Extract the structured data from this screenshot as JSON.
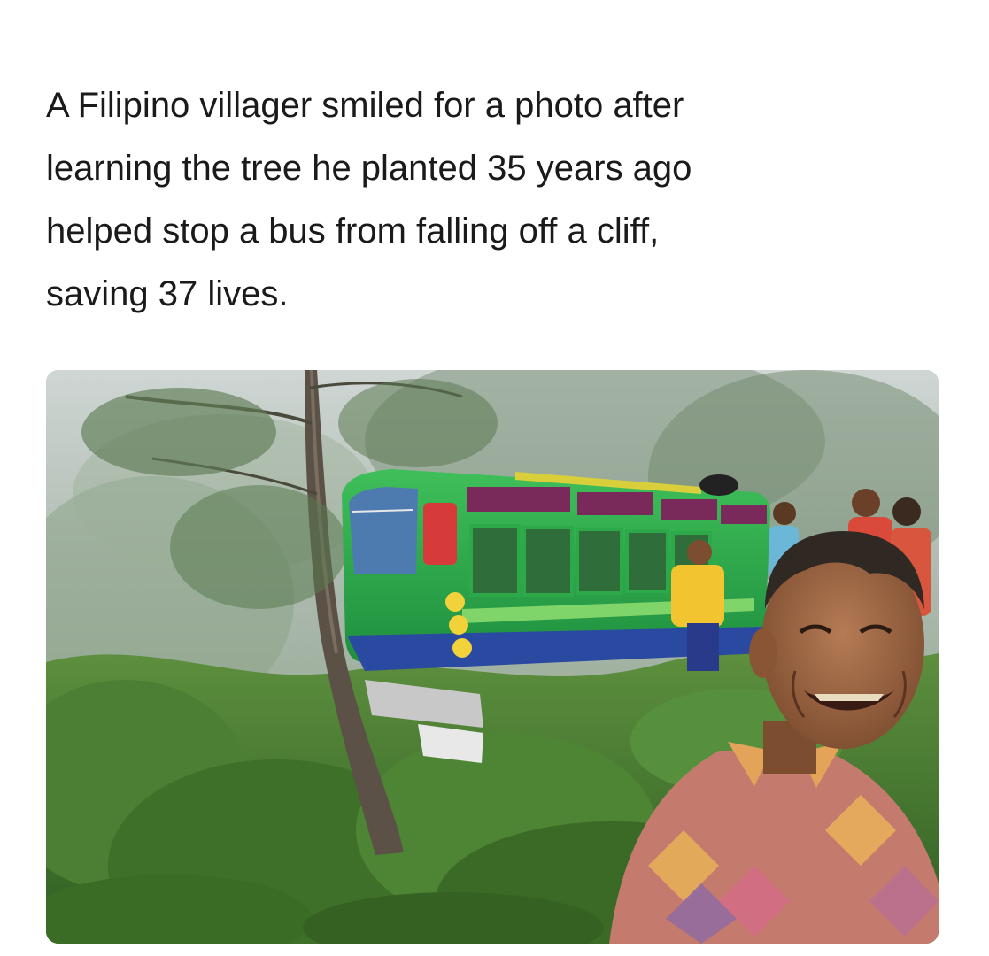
{
  "post": {
    "caption_lines": [
      "A Filipino villager smiled for a photo after",
      "learning the tree he planted 35 years ago",
      "helped stop a bus from falling off a cliff,",
      "saving 37 lives."
    ]
  },
  "photo": {
    "subject": "man-smiling-beside-bus-stopped-by-tree"
  }
}
